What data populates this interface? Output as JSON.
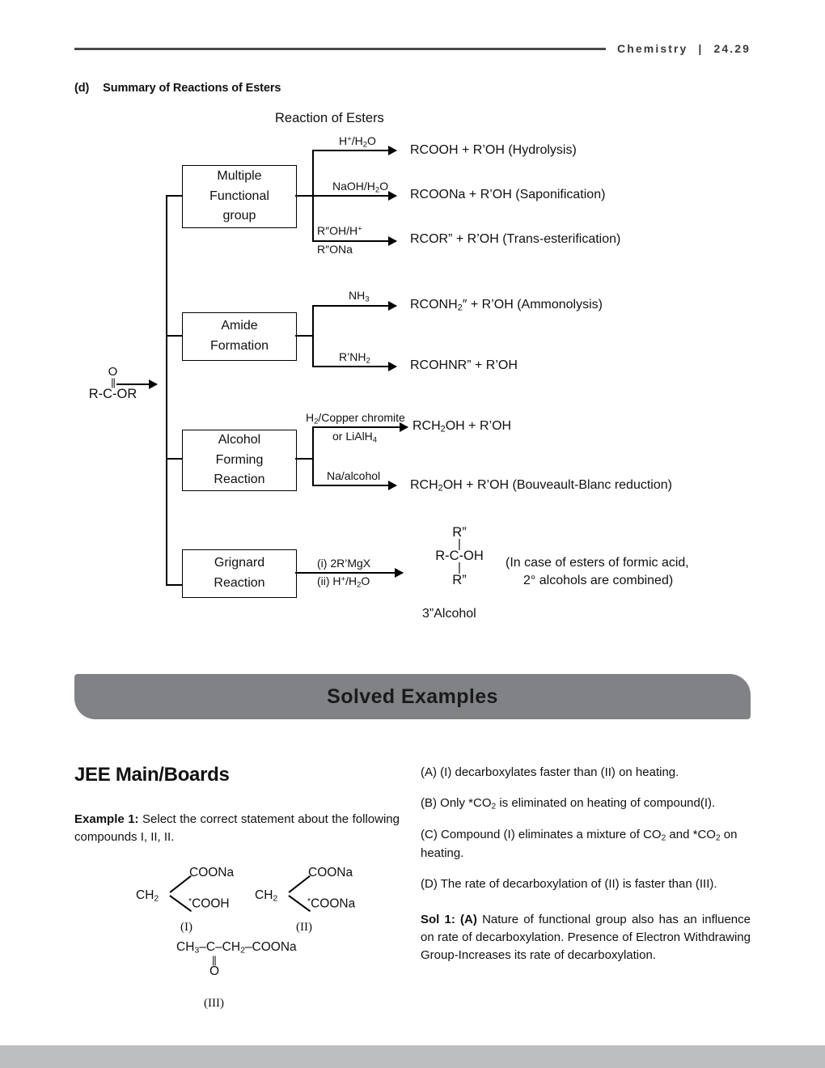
{
  "header": {
    "subject": "Chemistry",
    "separator": "|",
    "page_number": "24.29"
  },
  "section": {
    "label": "(d)",
    "title": "Summary of Reactions of Esters",
    "diagram_title": "Reaction of Esters"
  },
  "diagram": {
    "start_material": {
      "o_atom": "O",
      "double_bond": "||",
      "chain": "R-C-OR"
    },
    "branches": [
      {
        "box_label": "Multiple\nFunctional\ngroup",
        "box_lines": [
          "Multiple",
          "Functional",
          "group"
        ],
        "reactions": [
          {
            "cond_above": "H+/H2O",
            "cond_below": "",
            "product": "RCOOH + R’OH (Hydrolysis)"
          },
          {
            "cond_above": "NaOH/H2O",
            "cond_below": "",
            "product": "RCOONa + R’OH (Saponification)"
          },
          {
            "cond_above": "R”OH/H+",
            "cond_below": "R”ONa",
            "product": "RCOR” + R’OH (Trans-esterification)"
          }
        ]
      },
      {
        "box_lines": [
          "Amide",
          "Formation"
        ],
        "reactions": [
          {
            "cond_above": "NH3",
            "cond_below": "",
            "product": "RCONH2” + R’OH (Ammonolysis)"
          },
          {
            "cond_above": "R’NH2",
            "cond_below": "",
            "product": "RCOHNR” + R’OH"
          }
        ]
      },
      {
        "box_lines": [
          "Alcohol",
          "Forming",
          "Reaction"
        ],
        "reactions": [
          {
            "cond_above": "H2/Copper chromite",
            "cond_below": "or LiAlH4",
            "product": "RCH2OH + R’OH"
          },
          {
            "cond_above": "Na/alcohol",
            "cond_below": "",
            "product": "RCH2OH + R’OH (Bouveault-Blanc reduction)"
          }
        ]
      },
      {
        "box_lines": [
          "Grignard",
          "Reaction"
        ],
        "reactions": [
          {
            "cond_above": "(i) 2R’MgX",
            "cond_below": "(ii) H+/H2O",
            "product": ""
          }
        ],
        "product_structure": {
          "top": "R”",
          "middle": "R-C-OH",
          "bottom": "R”",
          "caption": "3”Alcohol",
          "note_line1": "(In case of esters of formic acid,",
          "note_line2": "2° alcohols are combined)"
        }
      }
    ]
  },
  "banner": {
    "title": "Solved Examples",
    "color": "#808285"
  },
  "left_column": {
    "heading": "JEE Main/Boards",
    "example_label": "Example 1:",
    "example_text": " Select the correct statement about the following compounds I, II, II.",
    "structures": [
      {
        "ch": "CH",
        "ch_sub": "2",
        "top": "COONa",
        "bottom": "*COOH",
        "roman": "(I)"
      },
      {
        "ch": "CH",
        "ch_sub": "2",
        "top": "COONa",
        "bottom": "*COONa",
        "roman": "(II)"
      }
    ],
    "structure3": {
      "chain": "CH3–C–CH2–COONa",
      "double_bond": "||",
      "o_atom": "O",
      "roman": "(III)"
    }
  },
  "right_column": {
    "options": [
      "(A) (I) decarboxylates faster than (II) on heating.",
      "(B) Only *CO2 is eliminated on heating of compound(I).",
      "(C) Compound (I) eliminates a mixture of CO2 and *CO2 on heating.",
      "(D) The rate of decarboxylation of (II) is faster than (III)."
    ],
    "solution_label": "Sol 1: (A)",
    "solution_text": " Nature of functional group also has an influence on rate of decarboxylation. Presence of Electron Withdrawing Group-Increases its rate of decarboxylation."
  },
  "footer": {
    "color": "#bcbec0"
  }
}
